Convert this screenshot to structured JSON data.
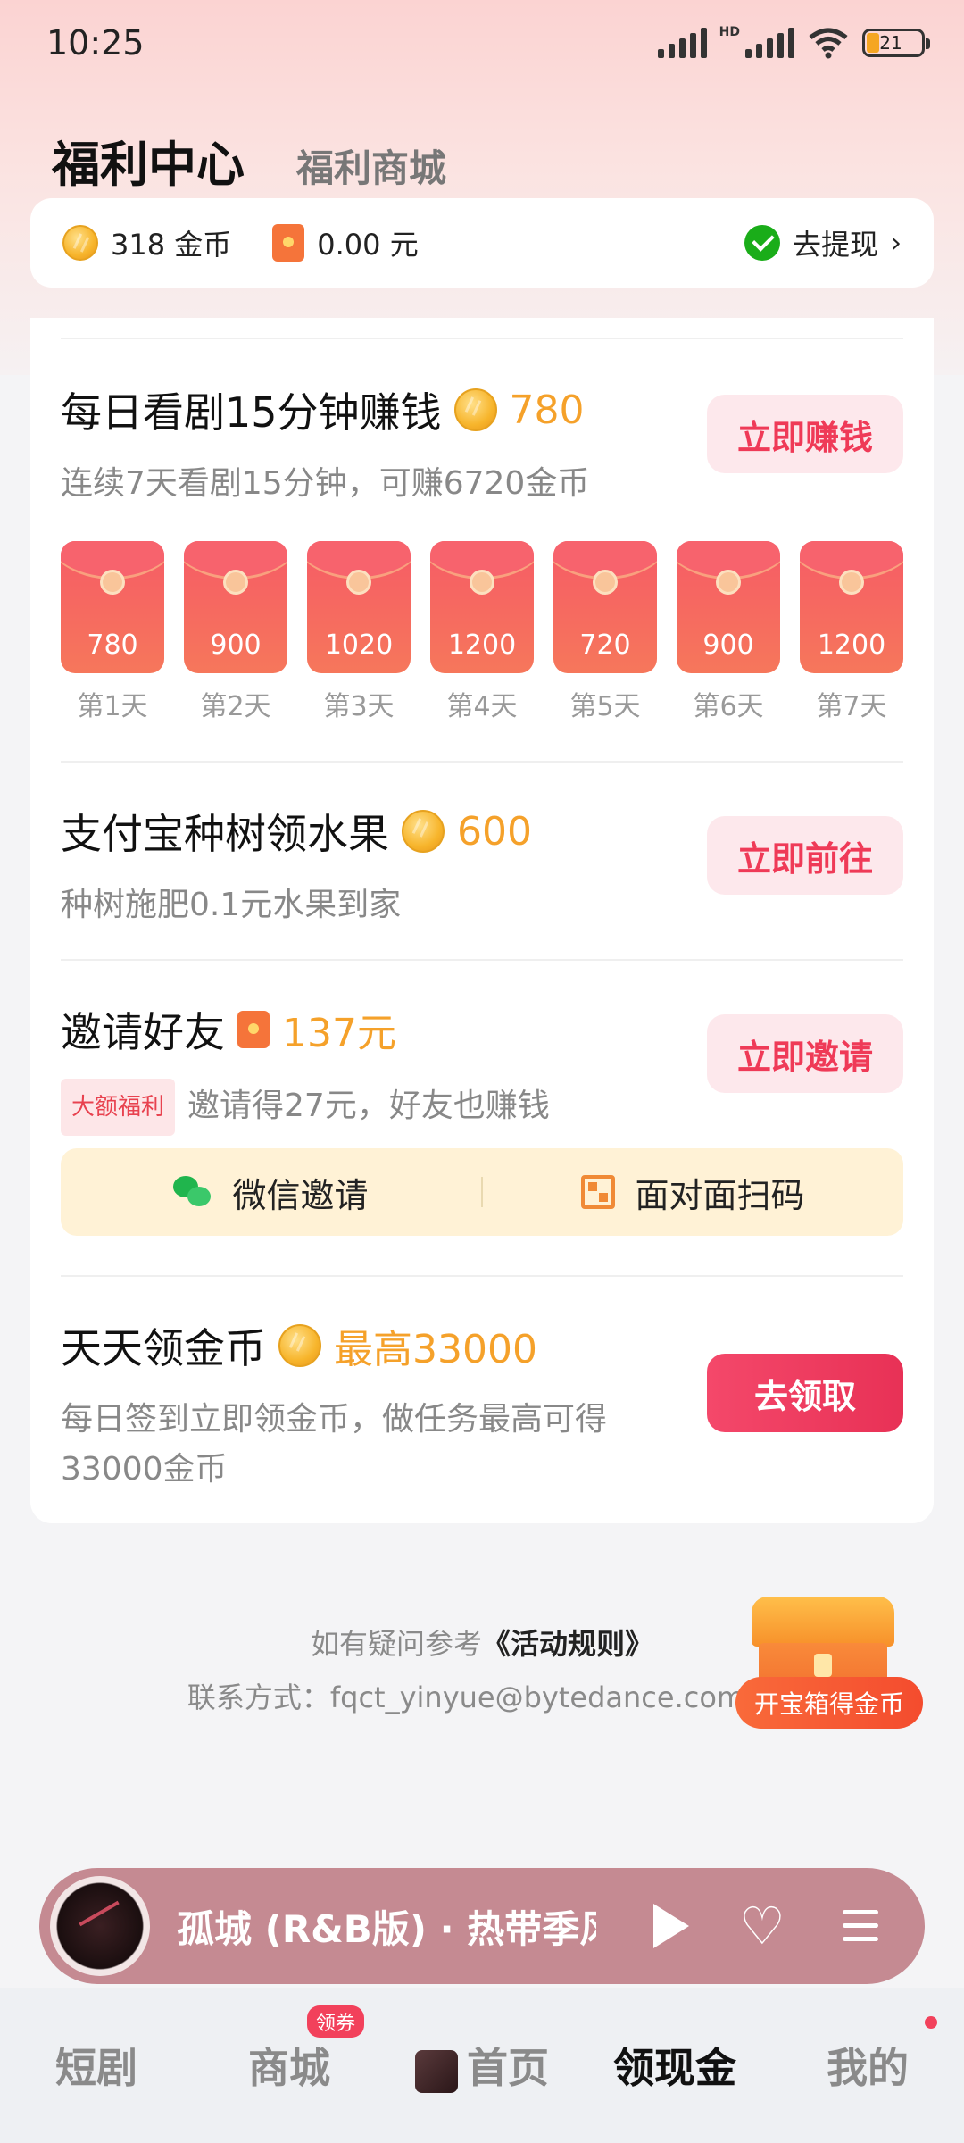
{
  "status_bar": {
    "time": "10:25",
    "hd": "HD",
    "battery": "21"
  },
  "header": {
    "tab_active": "福利中心",
    "tab_inactive": "福利商城"
  },
  "balance": {
    "coins": "318 金币",
    "cash": "0.00 元",
    "withdraw": "去提现",
    "chevron": "›"
  },
  "tasks": {
    "watch": {
      "title": "每日看剧15分钟赚钱",
      "reward": "780",
      "desc": "连续7天看剧15分钟，可赚6720金币",
      "button": "立即赚钱",
      "packets": [
        {
          "value": "780",
          "day": "第1天"
        },
        {
          "value": "900",
          "day": "第2天"
        },
        {
          "value": "1020",
          "day": "第3天"
        },
        {
          "value": "1200",
          "day": "第4天"
        },
        {
          "value": "720",
          "day": "第5天"
        },
        {
          "value": "900",
          "day": "第6天"
        },
        {
          "value": "1200",
          "day": "第7天"
        }
      ]
    },
    "alipay": {
      "title": "支付宝种树领水果",
      "reward": "600",
      "desc": "种树施肥0.1元水果到家",
      "button": "立即前往"
    },
    "invite": {
      "title": "邀请好友",
      "reward": "137元",
      "tag": "大额福利",
      "desc": "邀请得27元，好友也赚钱",
      "button": "立即邀请",
      "wechat_invite": "微信邀请",
      "qr_invite": "面对面扫码"
    },
    "daily": {
      "title": "天天领金币",
      "reward": "最高33000",
      "desc": "每日签到立即领金币，做任务最高可得33000金币",
      "button": "去领取"
    }
  },
  "footer": {
    "question_prefix": "如有疑问参考",
    "rules_link": "《活动规则》",
    "contact": "联系方式：fqct_yinyue@bytedance.com"
  },
  "chest": {
    "label": "开宝箱得金币"
  },
  "player": {
    "title": "孤城 (R&B版) · 热带季风"
  },
  "nav": {
    "items": [
      "短剧",
      "商城",
      "首页",
      "领现金",
      "我的"
    ],
    "badge": "领券"
  },
  "colors": {
    "accent": "#ef3a57",
    "reward": "#f5a12a",
    "invite_bg": "#fff2d6"
  }
}
